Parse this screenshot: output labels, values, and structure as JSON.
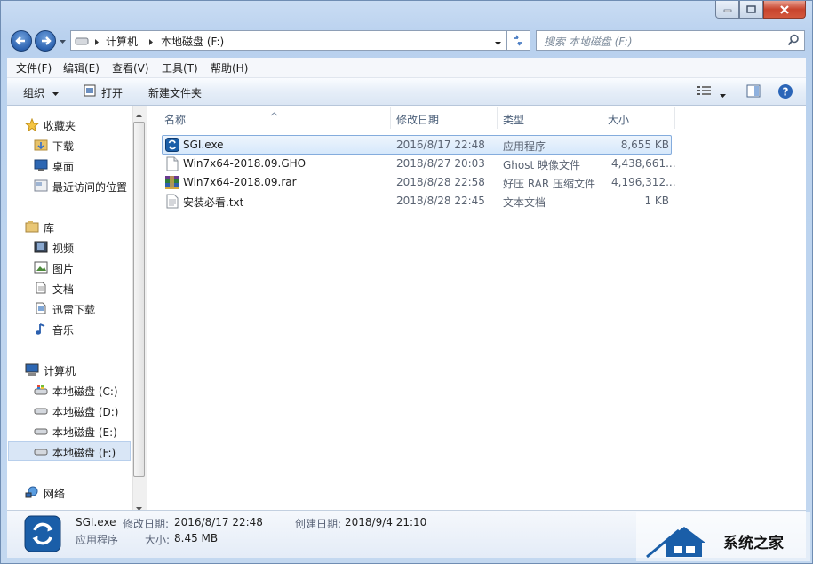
{
  "address": {
    "path": [
      "计算机",
      "本地磁盘 (F:)"
    ]
  },
  "search": {
    "placeholder": "搜索 本地磁盘 (F:)"
  },
  "menu": [
    "文件(F)",
    "编辑(E)",
    "查看(V)",
    "工具(T)",
    "帮助(H)"
  ],
  "commands": {
    "organize": "组织",
    "open": "打开",
    "new_folder": "新建文件夹"
  },
  "nav": {
    "favorites": "收藏夹",
    "favorite_items": [
      "下载",
      "桌面",
      "最近访问的位置"
    ],
    "libraries": "库",
    "library_items": [
      "视频",
      "图片",
      "文档",
      "迅雷下载",
      "音乐"
    ],
    "computer": "计算机",
    "drives": [
      "本地磁盘 (C:)",
      "本地磁盘 (D:)",
      "本地磁盘 (E:)",
      "本地磁盘 (F:)"
    ],
    "network": "网络"
  },
  "columns": [
    "名称",
    "修改日期",
    "类型",
    "大小"
  ],
  "files": [
    {
      "name": "SGI.exe",
      "date": "2016/8/17 22:48",
      "type": "应用程序",
      "size": "8,655 KB",
      "icon": "sgi-app-icon"
    },
    {
      "name": "Win7x64-2018.09.GHO",
      "date": "2018/8/27 20:03",
      "type": "Ghost 映像文件",
      "size": "4,438,661...",
      "icon": "generic-file-icon"
    },
    {
      "name": "Win7x64-2018.09.rar",
      "date": "2018/8/28 22:58",
      "type": "好压 RAR 压缩文件",
      "size": "4,196,312...",
      "icon": "rar-archive-icon"
    },
    {
      "name": "安装必看.txt",
      "date": "2018/8/28 22:45",
      "type": "文本文档",
      "size": "1 KB",
      "icon": "text-file-icon"
    }
  ],
  "details": {
    "name": "SGI.exe",
    "type": "应用程序",
    "modified_label": "修改日期:",
    "modified": "2016/8/17 22:48",
    "created_label": "创建日期:",
    "created": "2018/9/4 21:10",
    "size_label": "大小:",
    "size": "8.45 MB"
  },
  "watermark": "系统之家"
}
